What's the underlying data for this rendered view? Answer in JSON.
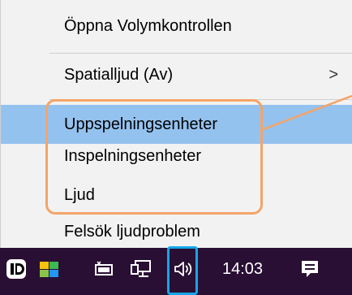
{
  "menu": {
    "items": [
      {
        "label": "Öppna Volymkontrollen"
      },
      {
        "label": "Spatialljud (Av)",
        "submenu_arrow": ">"
      },
      {
        "label": "Uppspelningsenheter",
        "highlighted": true
      },
      {
        "label": "Inspelningsenheter"
      },
      {
        "label": "Ljud"
      },
      {
        "label": "Felsök ljudproblem"
      }
    ]
  },
  "taskbar": {
    "icons": [
      "id-app-icon",
      "colorful-app-icon",
      "battery-icon",
      "network-icon",
      "volume-icon",
      "notification-icon"
    ],
    "clock": "14:03"
  },
  "colors": {
    "menu_bg": "#f2f2f2",
    "highlight": "#94c2ef",
    "callout": "#f4a468",
    "taskbar_bg": "#2a0f35",
    "volume_highlight": "#14a7e8"
  }
}
